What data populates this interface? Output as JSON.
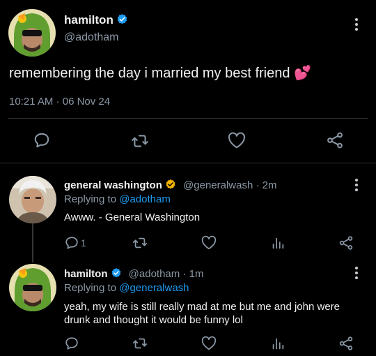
{
  "main_tweet": {
    "display_name": "hamilton",
    "handle": "@adotham",
    "text": "remembering the day i married my best friend",
    "emoji": "💕",
    "time": "10:21 AM",
    "date": "06 Nov 24"
  },
  "replies": [
    {
      "display_name": "general washington",
      "verified_color": "#f5b400",
      "handle": "@generalwash",
      "age": "2m",
      "replying_prefix": "Replying to ",
      "replying_to": "@adotham",
      "text": "Awww. - General Washington",
      "reply_count": "1"
    },
    {
      "display_name": "hamilton",
      "verified_color": "#1d9bf0",
      "handle": "@adotham",
      "age": "1m",
      "replying_prefix": "Replying to ",
      "replying_to": "@generalwash",
      "text": "yeah, my wife is still really mad at me but me and john were drunk and thought it would be funny lol"
    }
  ],
  "separator": "·",
  "icons": [
    "kebab-icon",
    "comment-icon",
    "retweet-icon",
    "heart-icon",
    "share-icon",
    "analytics-icon",
    "verified-icon"
  ],
  "colors": {
    "background": "#000000",
    "accent": "#1d9bf0",
    "muted": "#8b98a5",
    "gold_check": "#f5b400"
  }
}
